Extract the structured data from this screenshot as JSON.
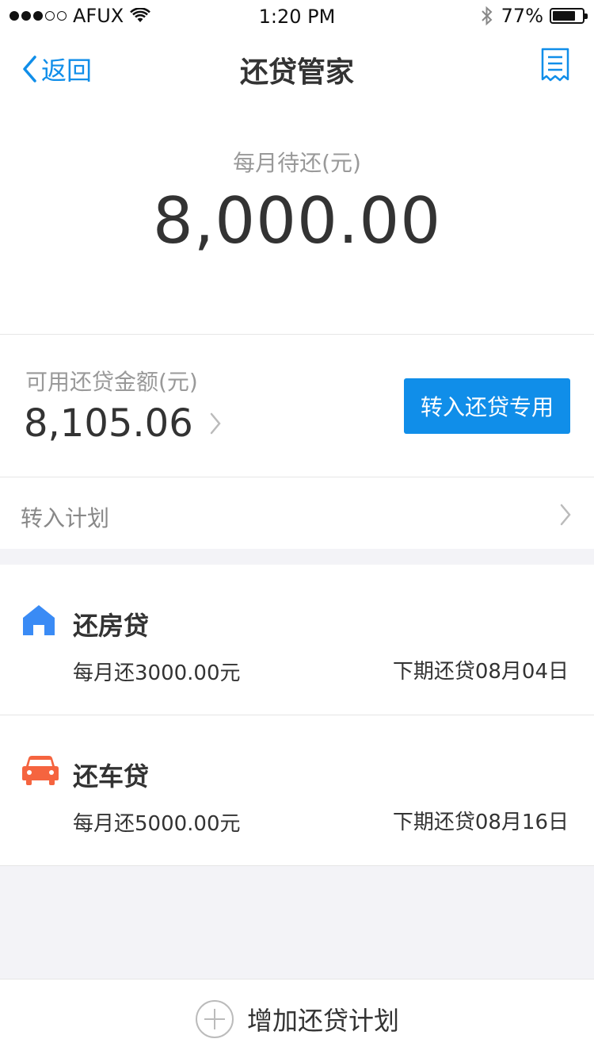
{
  "status_bar": {
    "carrier": "AFUX",
    "time": "1:20 PM",
    "battery": "77%",
    "battery_level": 0.77
  },
  "nav": {
    "back_label": "返回",
    "title": "还贷管家",
    "bill_icon": "bill-list-icon"
  },
  "hero": {
    "label": "每月待还(元)",
    "amount": "8,000.00"
  },
  "balance": {
    "label": "可用还贷金额(元)",
    "value": "8,105.06",
    "transfer_button": "转入还贷专用"
  },
  "plan": {
    "label": "转入计划"
  },
  "loans": [
    {
      "icon": "house-icon",
      "title": "还房贷",
      "monthly": "每月还3000.00元",
      "next": "下期还贷08月04日"
    },
    {
      "icon": "car-icon",
      "title": "还车贷",
      "monthly": "每月还5000.00元",
      "next": "下期还贷08月16日"
    }
  ],
  "footer": {
    "add_label": "增加还贷计划"
  },
  "colors": {
    "accent": "#108ee9",
    "house": "#3a8bf5",
    "car": "#f5643f",
    "background": "#f3f3f7"
  }
}
